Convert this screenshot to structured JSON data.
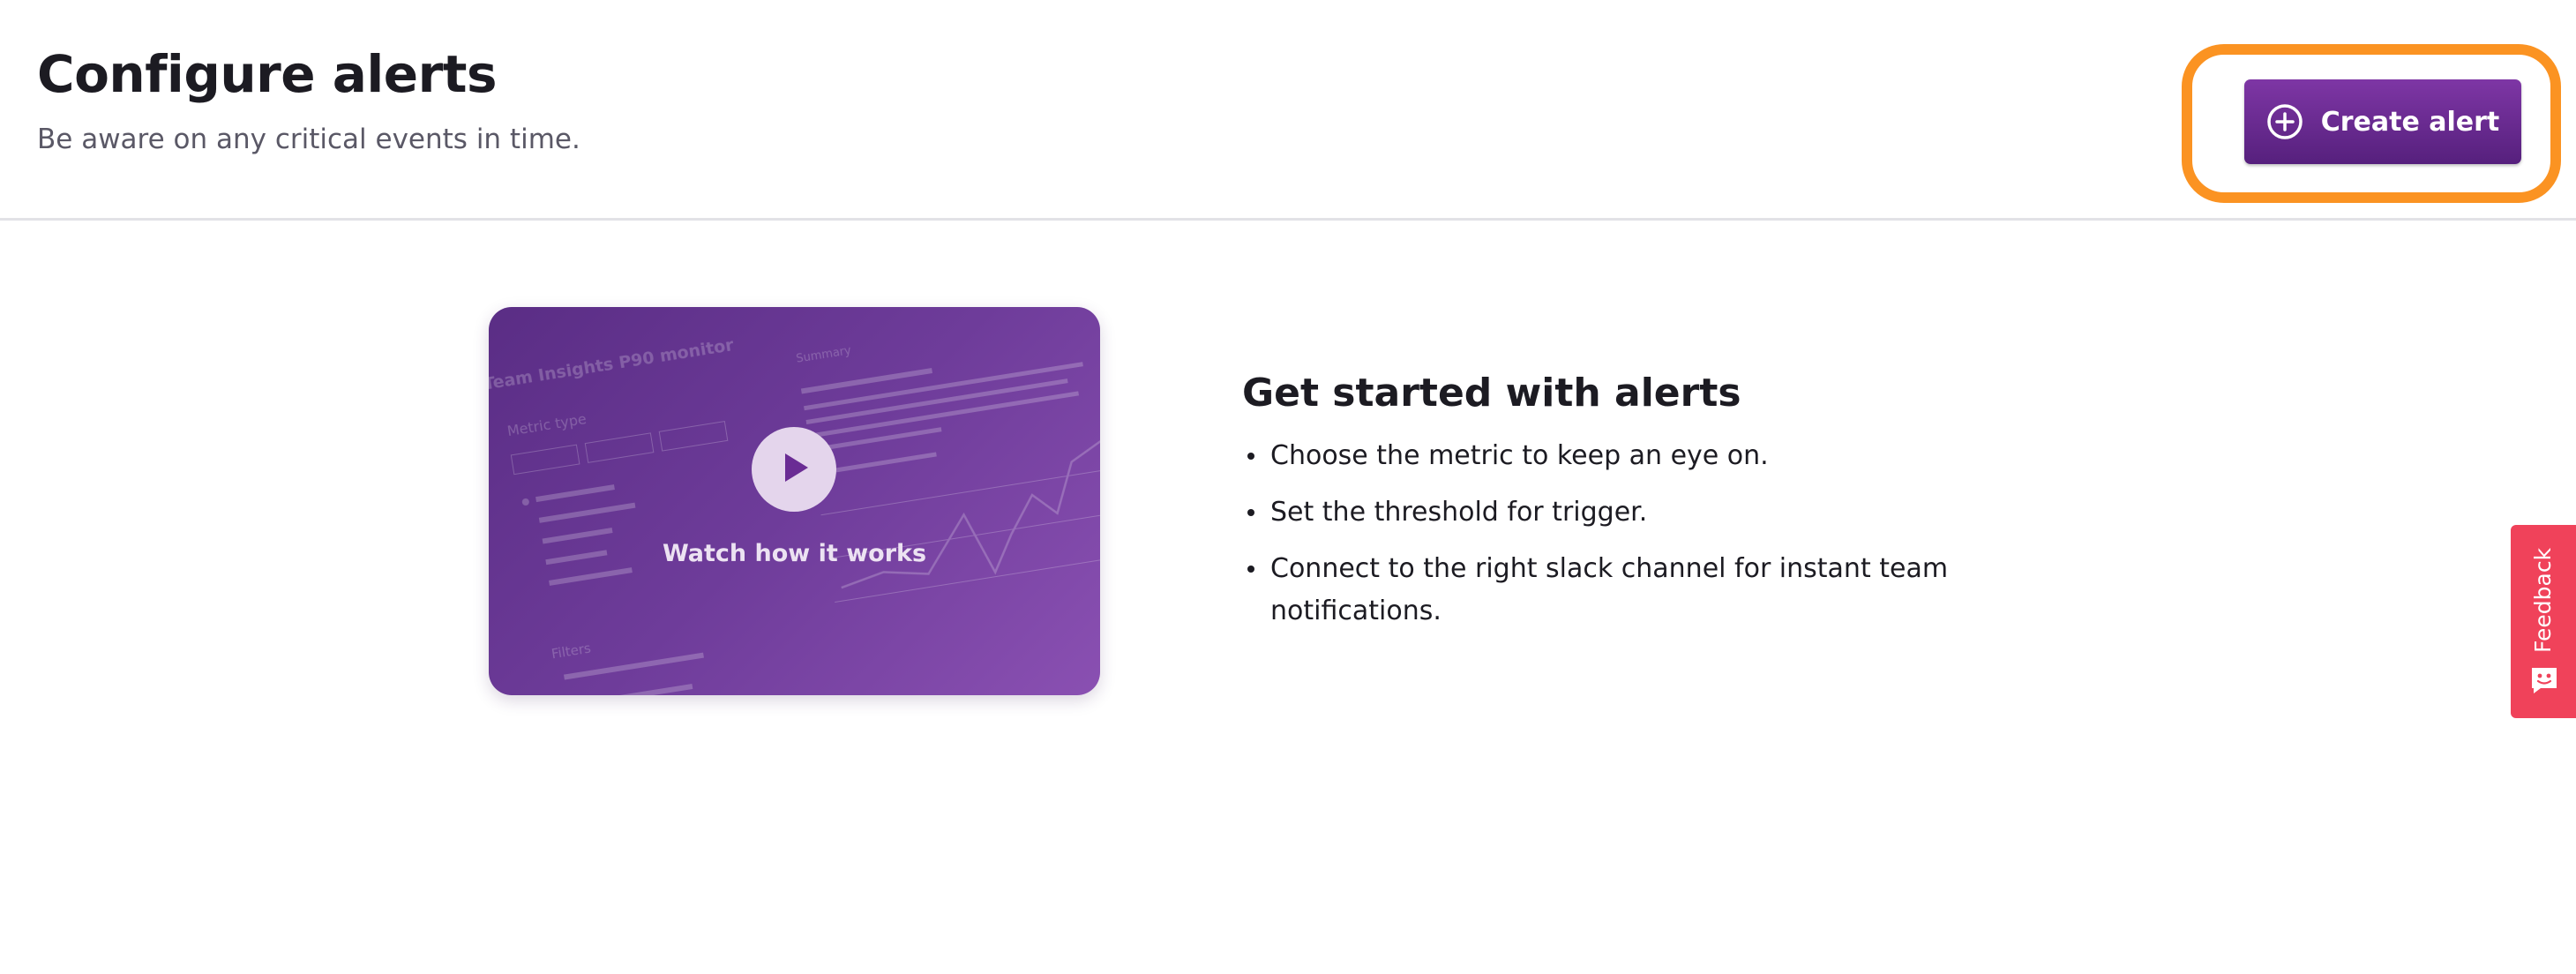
{
  "header": {
    "title": "Configure alerts",
    "subtitle": "Be aware on any critical events in time.",
    "create_button_label": "Create alert"
  },
  "video": {
    "caption": "Watch how it works",
    "preview_texts": {
      "heading": "Team Insights P90 monitor",
      "metric_type": "Metric type",
      "summary": "Summary",
      "filters": "Filters"
    }
  },
  "intro": {
    "title": "Get started with alerts",
    "items": [
      "Choose the metric to keep an eye on.",
      "Set the threshold for trigger.",
      "Connect to the right slack channel for instant team notifications."
    ]
  },
  "feedback": {
    "label": "Feedback"
  },
  "colors": {
    "brand_purple": "#6a2c94",
    "highlight_orange": "#fb9322",
    "feedback_red": "#f0425a"
  },
  "icons": {
    "create_button": "plus-circle-icon",
    "video": "play-icon",
    "feedback": "chat-face-icon"
  }
}
